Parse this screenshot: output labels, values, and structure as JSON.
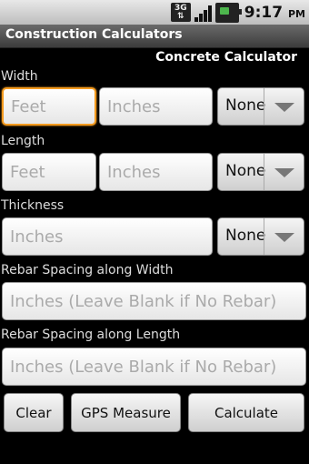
{
  "status_bar": {
    "network_icon": "3g-icon",
    "network_text": "3G",
    "signal_icon": "signal-icon",
    "battery_icon": "battery-charging-icon",
    "time": "9:17",
    "ampm": "PM"
  },
  "app": {
    "title": "Construction Calculators"
  },
  "screen": {
    "subtitle": "Concrete Calculator"
  },
  "form": {
    "width": {
      "label": "Width",
      "feet_placeholder": "Feet",
      "inches_placeholder": "Inches",
      "unit": "None"
    },
    "length": {
      "label": "Length",
      "feet_placeholder": "Feet",
      "inches_placeholder": "Inches",
      "unit": "None"
    },
    "thickness": {
      "label": "Thickness",
      "inches_placeholder": "Inches",
      "unit": "None"
    },
    "rebar_width": {
      "label": "Rebar Spacing along Width",
      "placeholder": "Inches (Leave Blank if No Rebar)"
    },
    "rebar_length": {
      "label": "Rebar Spacing along Length",
      "placeholder": "Inches (Leave Blank if No Rebar)"
    }
  },
  "buttons": {
    "clear": "Clear",
    "gps": "GPS Measure",
    "calculate": "Calculate"
  },
  "colors": {
    "focus": "#f39a1e",
    "background": "#000000"
  }
}
